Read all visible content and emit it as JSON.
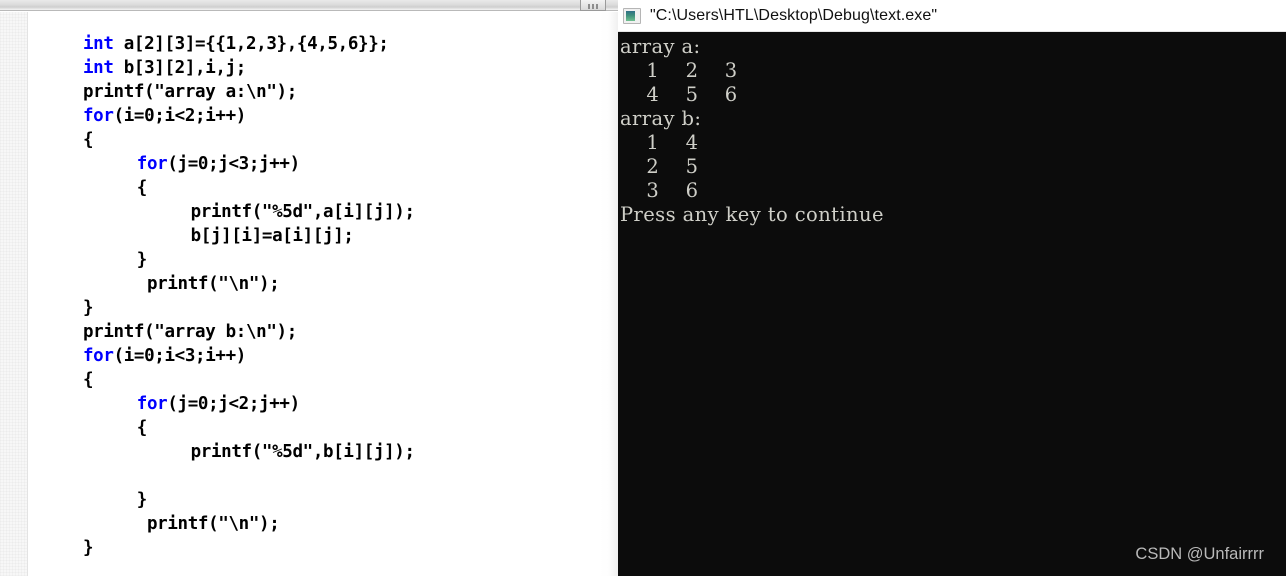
{
  "editor": {
    "window_name": "code-editor",
    "gutter_name": "editor-gutter",
    "code_lines": [
      {
        "indent": 0,
        "segments": [
          {
            "t": "int",
            "k": true
          },
          {
            "t": " a[2][3]={{1,2,3},{4,5,6}};",
            "k": false
          }
        ]
      },
      {
        "indent": 0,
        "segments": [
          {
            "t": "int",
            "k": true
          },
          {
            "t": " b[3][2],i,j;",
            "k": false
          }
        ]
      },
      {
        "indent": 0,
        "segments": [
          {
            "t": "printf(\"array a:\\n\");",
            "k": false
          }
        ]
      },
      {
        "indent": 0,
        "segments": [
          {
            "t": "for",
            "k": true
          },
          {
            "t": "(i=0;i<2;i++)",
            "k": false
          }
        ]
      },
      {
        "indent": 0,
        "segments": [
          {
            "t": "{",
            "k": false
          }
        ]
      },
      {
        "indent": 4,
        "segments": [
          {
            "t": "for",
            "k": true
          },
          {
            "t": "(j=0;j<3;j++)",
            "k": false
          }
        ]
      },
      {
        "indent": 4,
        "segments": [
          {
            "t": "{",
            "k": false
          }
        ]
      },
      {
        "indent": 8,
        "segments": [
          {
            "t": "printf(\"%5d\",a[i][j]);",
            "k": false
          }
        ]
      },
      {
        "indent": 8,
        "segments": [
          {
            "t": "b[j][i]=a[i][j];",
            "k": false
          }
        ]
      },
      {
        "indent": 4,
        "segments": [
          {
            "t": "}",
            "k": false
          }
        ]
      },
      {
        "indent": 4,
        "segments": [
          {
            "t": " printf(\"\\n\");",
            "k": false
          }
        ]
      },
      {
        "indent": 0,
        "segments": [
          {
            "t": "}",
            "k": false
          }
        ]
      },
      {
        "indent": 0,
        "segments": [
          {
            "t": "printf(\"array b:\\n\");",
            "k": false
          }
        ]
      },
      {
        "indent": 0,
        "segments": [
          {
            "t": "for",
            "k": true
          },
          {
            "t": "(i=0;i<3;i++)",
            "k": false
          }
        ]
      },
      {
        "indent": 0,
        "segments": [
          {
            "t": "{",
            "k": false
          }
        ]
      },
      {
        "indent": 4,
        "segments": [
          {
            "t": "for",
            "k": true
          },
          {
            "t": "(j=0;j<2;j++)",
            "k": false
          }
        ]
      },
      {
        "indent": 4,
        "segments": [
          {
            "t": "{",
            "k": false
          }
        ]
      },
      {
        "indent": 8,
        "segments": [
          {
            "t": "printf(\"%5d\",b[i][j]);",
            "k": false
          }
        ]
      },
      {
        "indent": 0,
        "segments": [
          {
            "t": "",
            "k": false
          }
        ]
      },
      {
        "indent": 4,
        "segments": [
          {
            "t": "}",
            "k": false
          }
        ]
      },
      {
        "indent": 4,
        "segments": [
          {
            "t": " printf(\"\\n\");",
            "k": false
          }
        ]
      },
      {
        "indent": 0,
        "segments": [
          {
            "t": "}",
            "k": false
          }
        ]
      }
    ],
    "keyword_color": "#0000ff",
    "text_color": "#000000",
    "background_color": "#ffffff"
  },
  "console": {
    "icon_name": "console-app-icon",
    "title": "\"C:\\Users\\HTL\\Desktop\\Debug\\text.exe\"",
    "background_color": "#0c0c0c",
    "text_color": "#cfcfc8",
    "output_lines": [
      "array a:",
      "    1    2    3",
      "    4    5    6",
      "array b:",
      "    1    4",
      "    2    5",
      "    3    6",
      "Press any key to continue"
    ]
  },
  "watermark": {
    "text": "CSDN @Unfairrrr",
    "color": "#b9b9b9"
  }
}
